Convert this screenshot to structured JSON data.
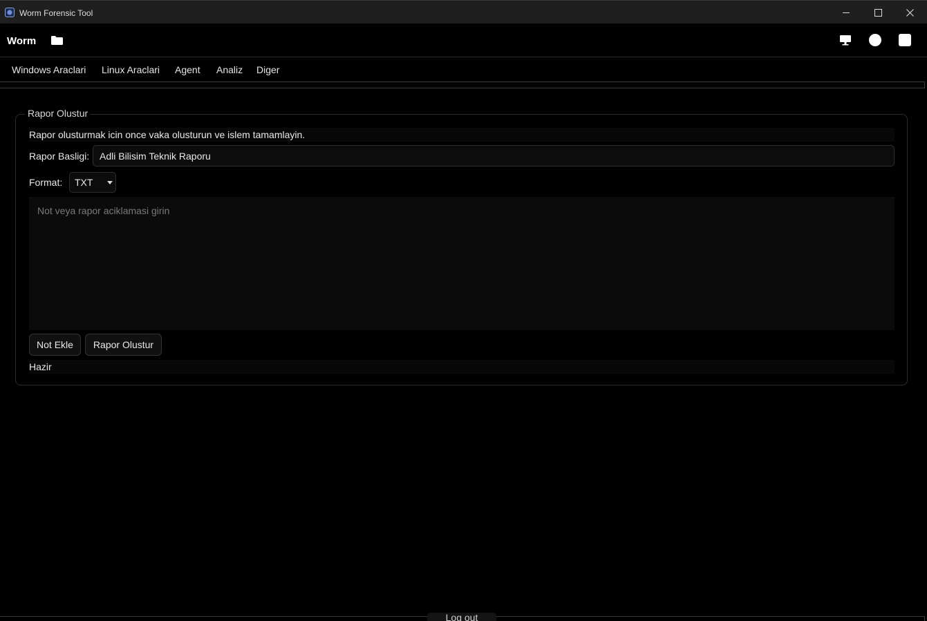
{
  "window": {
    "title": "Worm Forensic Tool"
  },
  "toolbar": {
    "brand": "Worm"
  },
  "menu": [
    "Windows Araclari",
    "Linux Araclari",
    "Agent",
    "Analiz",
    "Diger"
  ],
  "report": {
    "group_title": "Rapor Olustur",
    "info": "Rapor olusturmak icin once vaka olusturun ve islem tamamlayin.",
    "title_label": "Rapor Basligi:",
    "title_value": "Adli Bilisim Teknik Raporu",
    "format_label": "Format:",
    "format_value": "TXT",
    "notes_placeholder": "Not veya rapor aciklamasi girin",
    "add_note_label": "Not Ekle",
    "create_report_label": "Rapor Olustur",
    "status": "Hazir"
  },
  "footer": {
    "logout_label": "Log out"
  }
}
